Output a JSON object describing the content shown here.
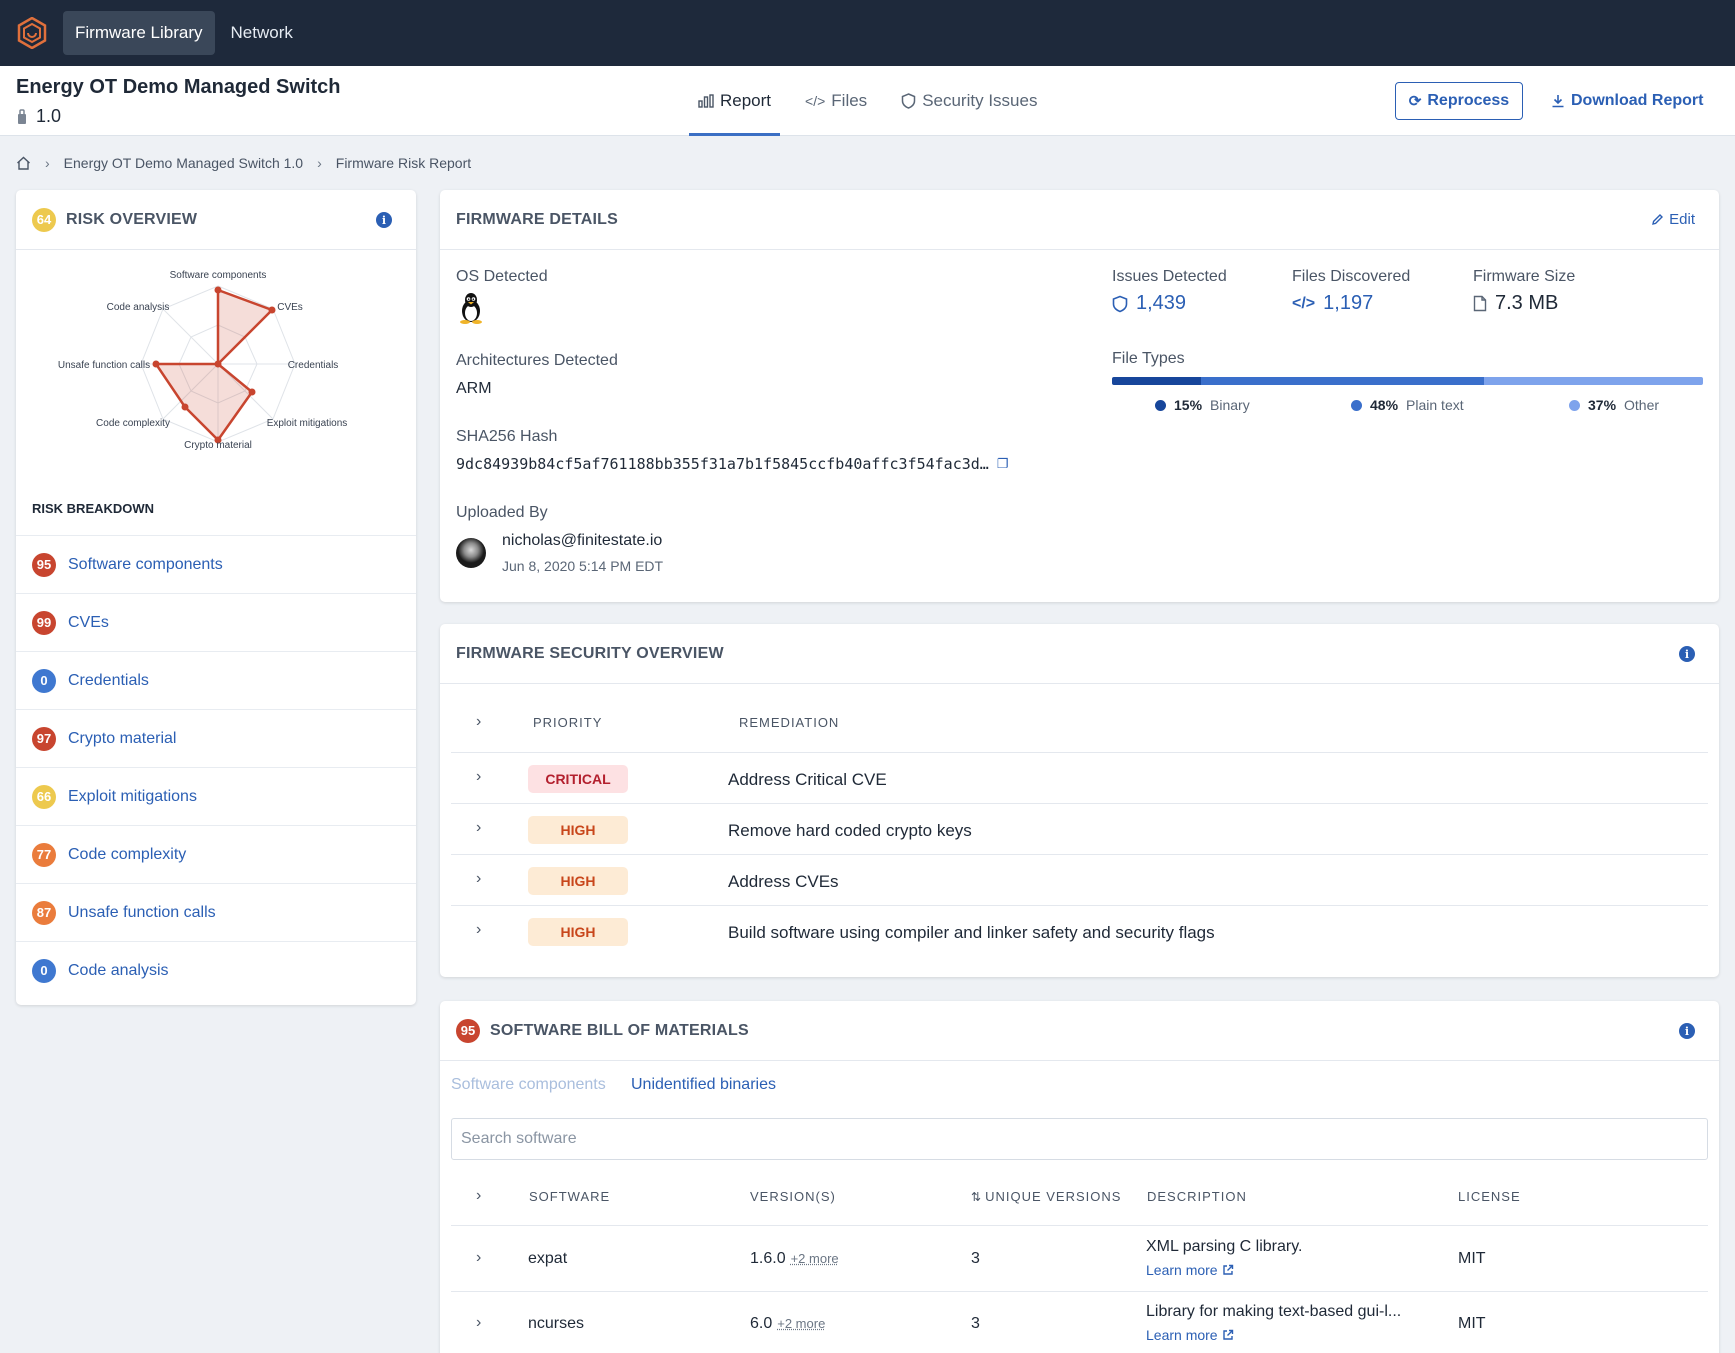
{
  "nav": {
    "items": [
      "Firmware Library",
      "Network"
    ]
  },
  "firmware": {
    "name": "Energy OT Demo Managed Switch",
    "version": "1.0"
  },
  "tabs": [
    "Report",
    "Files",
    "Security Issues"
  ],
  "actions": {
    "reprocess": "Reprocess",
    "download": "Download Report"
  },
  "breadcrumb": [
    "Energy OT Demo Managed Switch 1.0",
    "Firmware Risk Report"
  ],
  "risk_overview": {
    "score": "64",
    "title": "RISK OVERVIEW",
    "radar_axes": [
      "Software components",
      "CVEs",
      "Credentials",
      "Exploit mitigations",
      "Crypto material",
      "Code complexity",
      "Unsafe function calls",
      "Code analysis"
    ],
    "breakdown_title": "RISK BREAKDOWN",
    "breakdown": [
      {
        "score": "95",
        "label": "Software components",
        "color": "#c8452f"
      },
      {
        "score": "99",
        "label": "CVEs",
        "color": "#c8452f"
      },
      {
        "score": "0",
        "label": "Credentials",
        "color": "#3f78d0"
      },
      {
        "score": "97",
        "label": "Crypto material",
        "color": "#c8452f"
      },
      {
        "score": "66",
        "label": "Exploit mitigations",
        "color": "#edc94e"
      },
      {
        "score": "77",
        "label": "Code complexity",
        "color": "#ea7c3c"
      },
      {
        "score": "87",
        "label": "Unsafe function calls",
        "color": "#ea7c3c"
      },
      {
        "score": "0",
        "label": "Code analysis",
        "color": "#3f78d0"
      }
    ]
  },
  "details": {
    "title": "FIRMWARE DETAILS",
    "edit": "Edit",
    "os_label": "OS Detected",
    "arch_label": "Architectures Detected",
    "arch": "ARM",
    "sha_label": "SHA256 Hash",
    "sha": "9dc84939b84cf5af761188bb355f31a7b1f5845ccfb40affc3f54fac3d…",
    "uploaded_label": "Uploaded By",
    "uploader": "nicholas@finitestate.io",
    "uploaded_at": "Jun 8, 2020 5:14 PM EDT",
    "issues_label": "Issues Detected",
    "issues": "1,439",
    "files_label": "Files Discovered",
    "files": "1,197",
    "size_label": "Firmware Size",
    "size": "7.3 MB",
    "filetypes_label": "File Types",
    "filetypes": [
      {
        "pct": "15%",
        "name": "Binary",
        "value": 15,
        "color": "#17469b"
      },
      {
        "pct": "48%",
        "name": "Plain text",
        "value": 48,
        "color": "#3a6fcb"
      },
      {
        "pct": "37%",
        "name": "Other",
        "value": 37,
        "color": "#7ea3ec"
      }
    ]
  },
  "security": {
    "title": "FIRMWARE SECURITY OVERVIEW",
    "col_priority": "PRIORITY",
    "col_remediation": "REMEDIATION",
    "rows": [
      {
        "priority": "CRITICAL",
        "remediation": "Address Critical CVE"
      },
      {
        "priority": "HIGH",
        "remediation": "Remove hard coded crypto keys"
      },
      {
        "priority": "HIGH",
        "remediation": "Address CVEs"
      },
      {
        "priority": "HIGH",
        "remediation": "Build software using compiler and linker safety and security flags"
      }
    ]
  },
  "sbom": {
    "score": "95",
    "title": "SOFTWARE BILL OF MATERIALS",
    "tab_components": "Software components",
    "tab_unidentified": "Unidentified binaries",
    "search_placeholder": "Search software",
    "columns": [
      "SOFTWARE",
      "VERSION(S)",
      "UNIQUE VERSIONS",
      "DESCRIPTION",
      "LICENSE"
    ],
    "rows": [
      {
        "software": "expat",
        "version": "1.6.0",
        "more": "+2 more",
        "unique": "3",
        "description": "XML parsing C library.",
        "learn": "Learn more",
        "license": "MIT"
      },
      {
        "software": "ncurses",
        "version": "6.0",
        "more": "+2 more",
        "unique": "3",
        "description": "Library for making text-based gui-l...",
        "learn": "Learn more",
        "license": "MIT"
      }
    ]
  }
}
